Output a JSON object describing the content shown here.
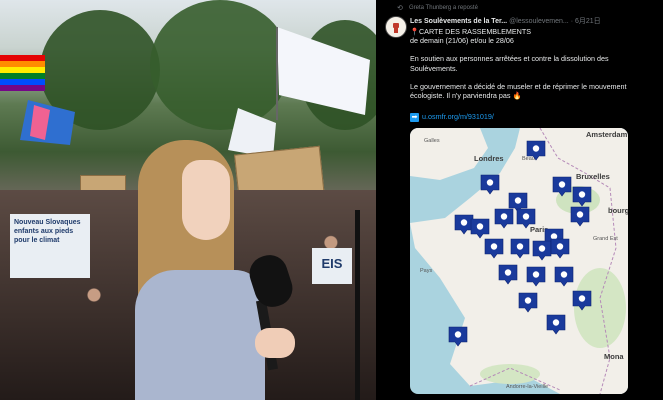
{
  "photo": {
    "sign_left": "Nouveau Slovaques enfants aux pieds pour le climat",
    "sign_right": "EIS"
  },
  "tweet": {
    "retweet_line": "Greta Thunberg a reposté",
    "author_name": "Les Soulèvements de la Ter...",
    "author_handle": "@lessoulevemen...",
    "date": "· 6月21日",
    "line1": "CARTE DES RASSEMBLEMENTS",
    "line2": "de demain (21/06) et/ou le 28/06",
    "para2": "En soutien aux personnes arrêtées et contre la dissolution des Soulèvements.",
    "para3": "Le gouvernement a décidé de museler et de réprimer le mouvement écologiste. Il n'y parviendra pas",
    "link": "u.osmfr.org/m/931019/",
    "icons": {
      "pin": "red-pin-icon",
      "link": "arrow-right-icon",
      "fire": "fire-icon"
    }
  },
  "map": {
    "labels": {
      "amsterdam": "Amsterdam",
      "londres": "Londres",
      "bruxelles": "Bruxelles",
      "paris": "Paris",
      "strasbourg": "bourg",
      "monaco": "Mona",
      "grand_est": "Grand Est",
      "galles": "Galles",
      "pays": "Pays",
      "andorre": "Andorre-la-Vieille",
      "beauv": "Beauv"
    },
    "marker_color": "#1a3a9c",
    "marker_count": 22
  }
}
